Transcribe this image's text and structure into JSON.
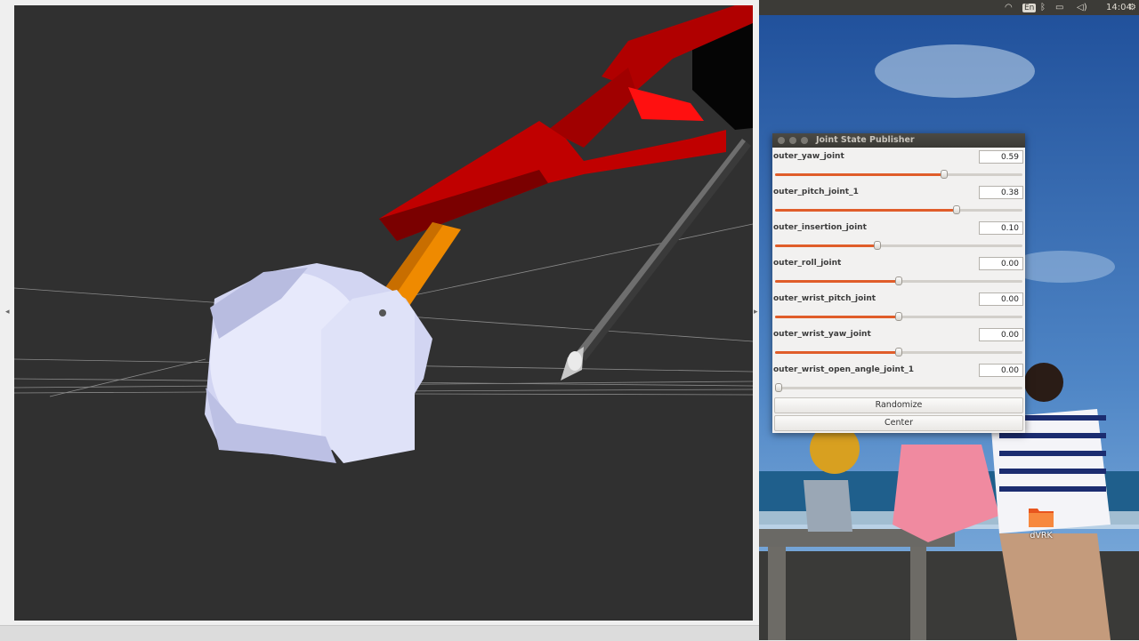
{
  "panel": {
    "title": "Joint State Publisher",
    "joints": [
      {
        "name": "outer_yaw_joint",
        "value": "0.59",
        "position": 0.69
      },
      {
        "name": "outer_pitch_joint_1",
        "value": "0.38",
        "position": 0.74
      },
      {
        "name": "outer_insertion_joint",
        "value": "0.10",
        "position": 0.41
      },
      {
        "name": "outer_roll_joint",
        "value": "0.00",
        "position": 0.5
      },
      {
        "name": "outer_wrist_pitch_joint",
        "value": "0.00",
        "position": 0.5
      },
      {
        "name": "outer_wrist_yaw_joint",
        "value": "0.00",
        "position": 0.5
      },
      {
        "name": "outer_wrist_open_angle_joint_1",
        "value": "0.00",
        "position": 0.0
      }
    ],
    "randomize_label": "Randomize",
    "center_label": "Center"
  },
  "topbar": {
    "lang": "En",
    "clock": "14:04"
  },
  "desktop": {
    "icon_label": "dVRK"
  },
  "colors": {
    "viewport_bg": "#303030",
    "slider_fill": "#e05d2a",
    "link_red": "#c80000",
    "link_orange": "#f08a00",
    "base_white": "#cfd2f0"
  }
}
